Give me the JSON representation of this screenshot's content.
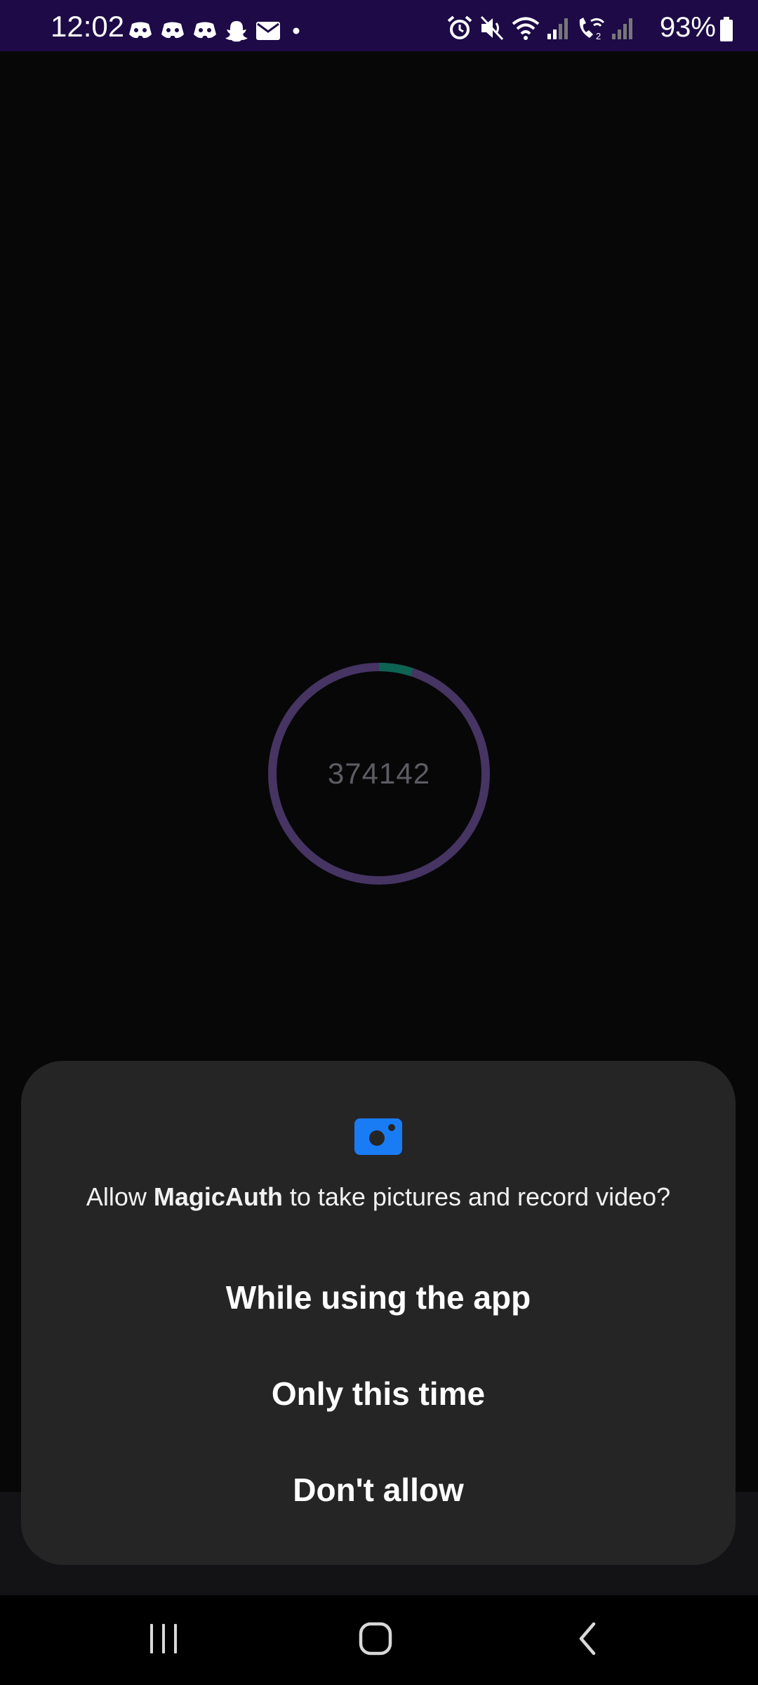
{
  "status_bar": {
    "time": "12:02",
    "battery_percent": "93%",
    "background_color": "#1d0a47",
    "notification_icons": [
      "discord-icon",
      "discord-icon",
      "discord-icon",
      "snapchat-icon",
      "mail-icon",
      "more-notifications-dot-icon"
    ],
    "system_icons": [
      "alarm-icon",
      "mute-icon",
      "wifi-icon",
      "signal-icon",
      "wifi-calling-icon",
      "signal-icon",
      "battery-icon"
    ]
  },
  "main": {
    "code": "374142",
    "ring_color": "#463463",
    "ring_progress_color": "#0d6452",
    "ring_progress_fraction": 0.05
  },
  "dialog": {
    "icon": "camera-icon",
    "icon_color": "#1a7cf5",
    "message_prefix": "Allow ",
    "app_name": "MagicAuth",
    "message_suffix": " to take pictures and record video?",
    "buttons": {
      "while_using": "While using the app",
      "only_this_time": "Only this time",
      "dont_allow": "Don't allow"
    }
  },
  "nav_bar": {
    "recents": "recents-icon",
    "home": "home-icon",
    "back": "back-icon"
  }
}
